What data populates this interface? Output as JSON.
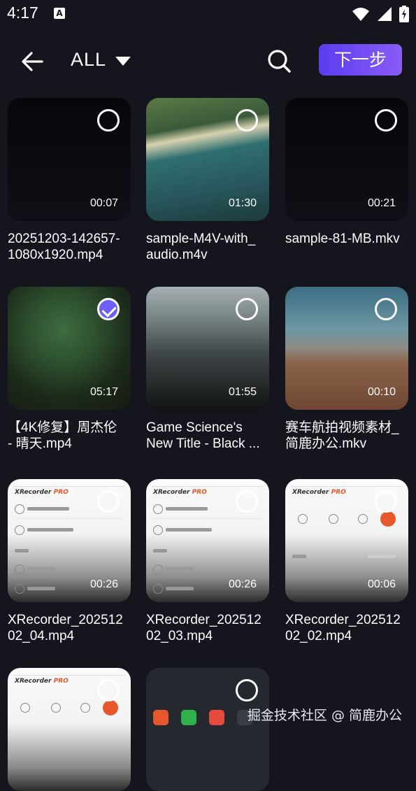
{
  "status": {
    "time": "4:17",
    "icons": [
      "a-badge-icon",
      "wifi-icon",
      "signal-icon",
      "battery-icon"
    ]
  },
  "appbar": {
    "filter_label": "ALL",
    "next_label": "下一步"
  },
  "videos": [
    {
      "name1": "20251203-142657-",
      "name2": "1080x1920.mp4",
      "duration": "00:07",
      "selected": false
    },
    {
      "name1": "sample-M4V-with_",
      "name2": "audio.m4v",
      "duration": "01:30",
      "selected": false
    },
    {
      "name1": "sample-81-MB.mkv",
      "name2": "",
      "duration": "00:21",
      "selected": false
    },
    {
      "name1": "【4K修复】周杰伦",
      "name2": "- 晴天.mp4",
      "duration": "05:17",
      "selected": true
    },
    {
      "name1": "Game Science's",
      "name2": "New Title - Black ...",
      "duration": "01:55",
      "selected": false
    },
    {
      "name1": "赛车航拍视频素材_",
      "name2": "简鹿办公.mkv",
      "duration": "00:10",
      "selected": false
    },
    {
      "name1": "XRecorder_202512",
      "name2": "02_04.mp4",
      "duration": "00:26",
      "selected": false
    },
    {
      "name1": "XRecorder_202512",
      "name2": "02_03.mp4",
      "duration": "00:26",
      "selected": false
    },
    {
      "name1": "XRecorder_202512",
      "name2": "02_02.mp4",
      "duration": "00:06",
      "selected": false
    },
    {
      "name1": "",
      "name2": "",
      "duration": "",
      "selected": false
    },
    {
      "name1": "",
      "name2": "",
      "duration": "",
      "selected": false
    }
  ],
  "watermark": "掘金技术社区 @ 简鹿办公",
  "colors": {
    "background": "#14151d",
    "accent": "#6d5ef5",
    "next_gradient_start": "#5b3cf0",
    "next_gradient_end": "#8a5cf7"
  }
}
